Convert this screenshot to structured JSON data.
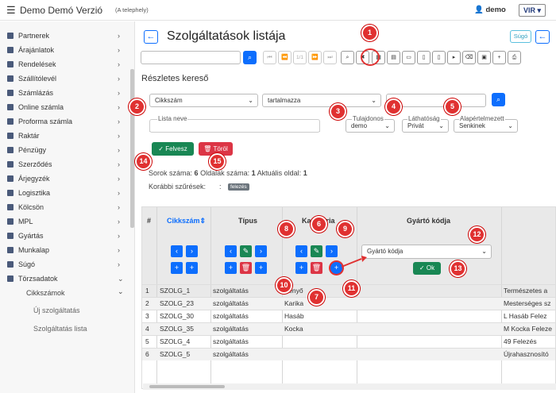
{
  "app": {
    "title": "Demo Demó Verzió",
    "subtitle": "(A telephely)",
    "user": "demo",
    "logo": "VIR"
  },
  "sidebar": {
    "items": [
      {
        "label": "Partnerek"
      },
      {
        "label": "Árajánlatok"
      },
      {
        "label": "Rendelések"
      },
      {
        "label": "Szállítólevél"
      },
      {
        "label": "Számlázás"
      },
      {
        "label": "Online számla"
      },
      {
        "label": "Proforma számla"
      },
      {
        "label": "Raktár"
      },
      {
        "label": "Pénzügy"
      },
      {
        "label": "Szerződés"
      },
      {
        "label": "Árjegyzék"
      },
      {
        "label": "Logisztika"
      },
      {
        "label": "Kölcsön"
      },
      {
        "label": "MPL"
      },
      {
        "label": "Gyártás"
      },
      {
        "label": "Munkalap"
      },
      {
        "label": "Súgó"
      },
      {
        "label": "Törzsadatok"
      }
    ],
    "sub_group": "Cikkszámok",
    "sub_items": [
      "Új szolgáltatás",
      "Szolgáltatás lista"
    ]
  },
  "page": {
    "title": "Szolgáltatások listája",
    "help": "Súgó",
    "back": "←",
    "section_title": "Részletes kereső"
  },
  "toolbar": {
    "pager": "1/1"
  },
  "filter": {
    "field": "Cikkszám",
    "operator": "tartalmazza",
    "value": "",
    "list_name_label": "Lista neve",
    "owner_label": "Tulajdonos",
    "owner_value": "demo",
    "visibility_label": "Láthatóság",
    "visibility_value": "Privát",
    "default_label": "Alapértelmezett",
    "default_value": "Senkinek",
    "save_label": "Felvesz",
    "delete_label": "Töröl"
  },
  "stats": {
    "rows_label": "Sorok száma:",
    "rows": "6",
    "pages_label": "Oldalak száma:",
    "pages": "1",
    "current_label": "Aktuális oldal:",
    "current": "1",
    "prev_filters_label": "Korábbi szűrések:",
    "prev_sep": ":",
    "prev_badge": "felezés"
  },
  "table": {
    "headers": [
      "#",
      "Cikkszám",
      "Típus",
      "Kategória",
      "Gyártó kódja"
    ],
    "maker_select": "Gyártó kódja",
    "ok_label": "Ok",
    "rows": [
      [
        "1",
        "SZOLG_1",
        "szolgáltatás",
        "Fenyő",
        "Természetes a"
      ],
      [
        "2",
        "SZOLG_23",
        "szolgáltatás",
        "Karika",
        "Mesterséges sz"
      ],
      [
        "3",
        "SZOLG_30",
        "szolgáltatás",
        "Hasáb",
        "L Hasáb Felez"
      ],
      [
        "4",
        "SZOLG_35",
        "szolgáltatás",
        "Kocka",
        "M Kocka Feleze"
      ],
      [
        "5",
        "SZOLG_4",
        "szolgáltatás",
        "",
        "49 Felezés"
      ],
      [
        "6",
        "SZOLG_5",
        "szolgáltatás",
        "",
        "Újrahasznosító"
      ]
    ]
  },
  "callouts": [
    "1",
    "2",
    "3",
    "4",
    "5",
    "6",
    "7",
    "8",
    "9",
    "10",
    "11",
    "12",
    "13",
    "14",
    "15"
  ],
  "colors": {
    "primary": "#0d6efd",
    "success": "#198754",
    "danger": "#dc3545",
    "callout": "#e03131"
  }
}
